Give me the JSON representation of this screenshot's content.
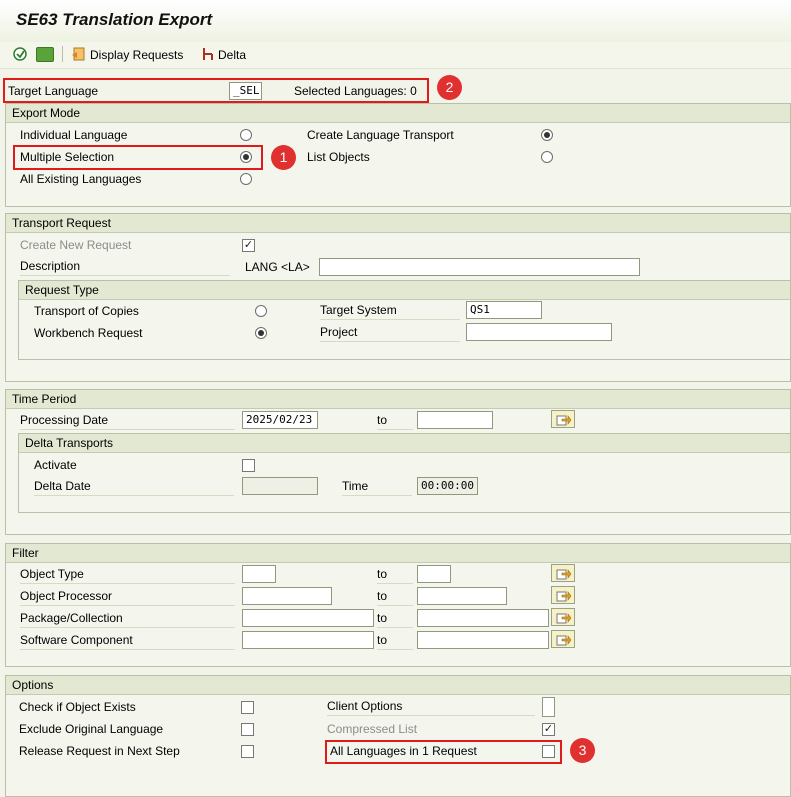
{
  "window": {
    "title": "SE63 Translation Export"
  },
  "toolbar": {
    "display_requests": "Display Requests",
    "delta": "Delta"
  },
  "target": {
    "label": "Target Language",
    "value": "_SEL",
    "selected_text": "Selected Languages: 0"
  },
  "export_mode": {
    "title": "Export Mode",
    "individual": "Individual Language",
    "multiple": "Multiple Selection",
    "all_existing": "All Existing Languages",
    "create_transport": "Create Language Transport",
    "list_objects": "List Objects"
  },
  "transport": {
    "title": "Transport Request",
    "create_new": "Create New Request",
    "description": "Description",
    "desc_prefix": "LANG <LA>",
    "desc_value": "",
    "request_type": {
      "title": "Request Type",
      "copies": "Transport of Copies",
      "workbench": "Workbench Request",
      "target_system": "Target System",
      "target_system_value": "QS1",
      "project": "Project",
      "project_value": ""
    }
  },
  "time_period": {
    "title": "Time Period",
    "processing_date": "Processing Date",
    "date_from": "2025/02/23",
    "to": "to",
    "date_to": "",
    "delta": {
      "title": "Delta Transports",
      "activate": "Activate",
      "delta_date": "Delta Date",
      "delta_date_value": "",
      "time": "Time",
      "time_value": "00:00:00"
    }
  },
  "filter": {
    "title": "Filter",
    "to": "to",
    "rows": [
      {
        "label": "Object Type",
        "from": "",
        "to": ""
      },
      {
        "label": "Object Processor",
        "from": "",
        "to": ""
      },
      {
        "label": "Package/Collection",
        "from": "",
        "to": ""
      },
      {
        "label": "Software Component",
        "from": "",
        "to": ""
      }
    ]
  },
  "options": {
    "title": "Options",
    "check_exists": "Check if Object Exists",
    "exclude_original": "Exclude Original Language",
    "release_next": "Release Request in Next Step",
    "client_options": "Client Options",
    "compressed_list": "Compressed List",
    "all_in_one": "All Languages in 1 Request"
  },
  "annotations": {
    "b1": "1",
    "b2": "2",
    "b3": "3"
  },
  "colors": {
    "highlight": "#e01b1b",
    "badge": "#e03030",
    "panel": "#f4f6ed"
  }
}
